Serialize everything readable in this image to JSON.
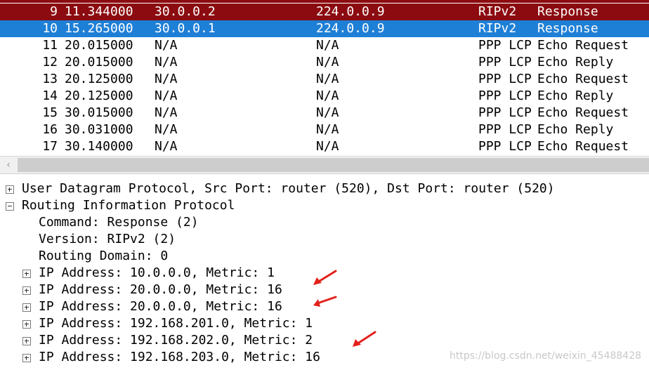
{
  "packets": [
    {
      "no": "9",
      "time": "11.344000",
      "source": "30.0.0.2",
      "destination": "224.0.0.9",
      "protocol": "RIPv2",
      "info": "Response",
      "style": "sel-dark"
    },
    {
      "no": "10",
      "time": "15.265000",
      "source": "30.0.0.1",
      "destination": "224.0.0.9",
      "protocol": "RIPv2",
      "info": "Response",
      "style": "sel-blue"
    },
    {
      "no": "11",
      "time": "20.015000",
      "source": "N/A",
      "destination": "N/A",
      "protocol": "PPP LCP",
      "info": "Echo Request",
      "style": ""
    },
    {
      "no": "12",
      "time": "20.015000",
      "source": "N/A",
      "destination": "N/A",
      "protocol": "PPP LCP",
      "info": "Echo Reply",
      "style": ""
    },
    {
      "no": "13",
      "time": "20.125000",
      "source": "N/A",
      "destination": "N/A",
      "protocol": "PPP LCP",
      "info": "Echo Request",
      "style": ""
    },
    {
      "no": "14",
      "time": "20.125000",
      "source": "N/A",
      "destination": "N/A",
      "protocol": "PPP LCP",
      "info": "Echo Reply",
      "style": ""
    },
    {
      "no": "15",
      "time": "30.015000",
      "source": "N/A",
      "destination": "N/A",
      "protocol": "PPP LCP",
      "info": "Echo Request",
      "style": ""
    },
    {
      "no": "16",
      "time": "30.031000",
      "source": "N/A",
      "destination": "N/A",
      "protocol": "PPP LCP",
      "info": "Echo Reply",
      "style": ""
    },
    {
      "no": "17",
      "time": "30.140000",
      "source": "N/A",
      "destination": "N/A",
      "protocol": "PPP LCP",
      "info": "Echo Request",
      "style": ""
    }
  ],
  "scrollbar": {
    "left_arrow": "‹"
  },
  "details": {
    "udp": "User Datagram Protocol, Src Port: router (520), Dst Port: router (520)",
    "rip": "Routing Information Protocol",
    "command": "Command: Response (2)",
    "version": "Version: RIPv2 (2)",
    "domain": "Routing Domain: 0",
    "entries": [
      "IP Address: 10.0.0.0, Metric: 1",
      "IP Address: 20.0.0.0, Metric: 16",
      "IP Address: 20.0.0.0, Metric: 16",
      "IP Address: 192.168.201.0, Metric: 1",
      "IP Address: 192.168.202.0, Metric: 2",
      "IP Address: 192.168.203.0, Metric: 16"
    ]
  },
  "annotation_color": "#e3211c",
  "watermark": "https://blog.csdn.net/weixin_45488428"
}
